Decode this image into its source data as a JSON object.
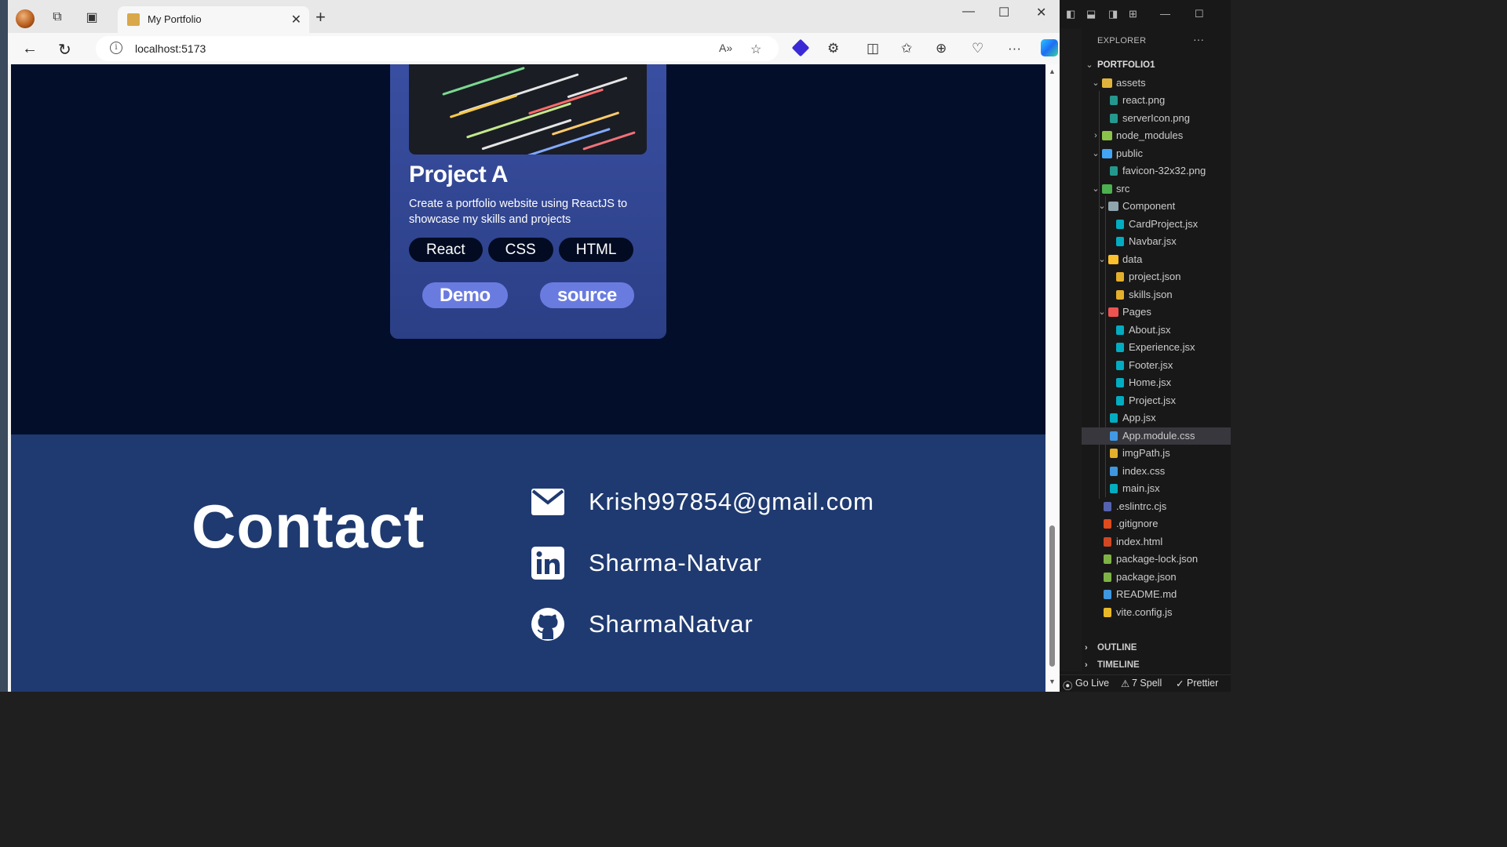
{
  "browser": {
    "tab_title": "My Portfolio",
    "tab_close": "✕",
    "new_tab": "+",
    "url": "localhost:5173",
    "window_controls": [
      "—",
      "☐",
      "✕"
    ]
  },
  "project_card": {
    "title": "Project A",
    "description": "Create a portfolio website using ReactJS to showcase my skills and projects",
    "tags": [
      "React",
      "CSS",
      "HTML"
    ],
    "demo_label": "Demo",
    "source_label": "source"
  },
  "contact": {
    "title": "Contact",
    "email": "Krish997854@gmail.com",
    "linkedin": "Sharma-Natvar",
    "github": "SharmaNatvar"
  },
  "vscode": {
    "explorer_label": "EXPLORER",
    "more": "···",
    "root": "PORTFOLIO1",
    "tree": [
      {
        "name": "assets",
        "type": "folder-open",
        "level": 1,
        "color": "#e2b33c"
      },
      {
        "name": "react.png",
        "type": "file",
        "level": 2,
        "color": "#26a69a"
      },
      {
        "name": "serverIcon.png",
        "type": "file",
        "level": 2,
        "color": "#26a69a"
      },
      {
        "name": "node_modules",
        "type": "folder-closed",
        "level": 1,
        "color": "#8bc34a"
      },
      {
        "name": "public",
        "type": "folder-open",
        "level": 1,
        "color": "#42a5f5"
      },
      {
        "name": "favicon-32x32.png",
        "type": "file",
        "level": 2,
        "color": "#26a69a"
      },
      {
        "name": "src",
        "type": "folder-open",
        "level": 1,
        "color": "#4caf50"
      },
      {
        "name": "Component",
        "type": "folder-open",
        "level": 2,
        "color": "#90a4ae"
      },
      {
        "name": "CardProject.jsx",
        "type": "file",
        "level": 3,
        "color": "#00bcd4"
      },
      {
        "name": "Navbar.jsx",
        "type": "file",
        "level": 3,
        "color": "#00bcd4"
      },
      {
        "name": "data",
        "type": "folder-open",
        "level": 2,
        "color": "#fbc02d"
      },
      {
        "name": "project.json",
        "type": "file",
        "level": 3,
        "color": "#fbc02d"
      },
      {
        "name": "skills.json",
        "type": "file",
        "level": 3,
        "color": "#fbc02d"
      },
      {
        "name": "Pages",
        "type": "folder-open",
        "level": 2,
        "color": "#ef5350"
      },
      {
        "name": "About.jsx",
        "type": "file",
        "level": 3,
        "color": "#00bcd4"
      },
      {
        "name": "Experience.jsx",
        "type": "file",
        "level": 3,
        "color": "#00bcd4"
      },
      {
        "name": "Footer.jsx",
        "type": "file",
        "level": 3,
        "color": "#00bcd4"
      },
      {
        "name": "Home.jsx",
        "type": "file",
        "level": 3,
        "color": "#00bcd4"
      },
      {
        "name": "Project.jsx",
        "type": "file",
        "level": 3,
        "color": "#00bcd4"
      },
      {
        "name": "App.jsx",
        "type": "file",
        "level": 2,
        "color": "#00bcd4"
      },
      {
        "name": "App.module.css",
        "type": "file",
        "level": 2,
        "color": "#42a5f5",
        "selected": true
      },
      {
        "name": "imgPath.js",
        "type": "file",
        "level": 2,
        "color": "#fbc02d"
      },
      {
        "name": "index.css",
        "type": "file",
        "level": 2,
        "color": "#42a5f5"
      },
      {
        "name": "main.jsx",
        "type": "file",
        "level": 2,
        "color": "#00bcd4"
      },
      {
        "name": ".eslintrc.cjs",
        "type": "file",
        "level": 1,
        "color": "#5c6bc0"
      },
      {
        "name": ".gitignore",
        "type": "file",
        "level": 1,
        "color": "#f4511e"
      },
      {
        "name": "index.html",
        "type": "file",
        "level": 1,
        "color": "#e44d26"
      },
      {
        "name": "package-lock.json",
        "type": "file",
        "level": 1,
        "color": "#8bc34a"
      },
      {
        "name": "package.json",
        "type": "file",
        "level": 1,
        "color": "#8bc34a"
      },
      {
        "name": "README.md",
        "type": "file",
        "level": 1,
        "color": "#42a5f5"
      },
      {
        "name": "vite.config.js",
        "type": "file",
        "level": 1,
        "color": "#ffca28"
      }
    ],
    "outline": "OUTLINE",
    "timeline": "TIMELINE",
    "status_golive": "Go Live",
    "status_spell": "7 Spell",
    "status_prettier": "Prettier"
  }
}
